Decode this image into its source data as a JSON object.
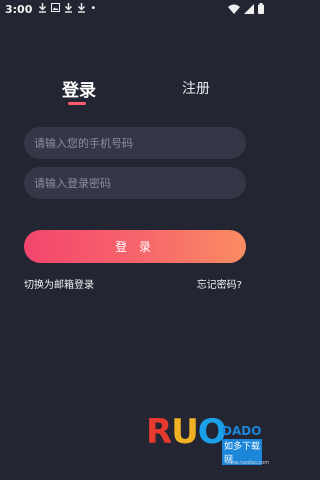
{
  "status_bar": {
    "time": "3:00",
    "notifications": [
      "download-icon",
      "image-icon",
      "download-icon",
      "download-icon"
    ],
    "dot": "•"
  },
  "tabs": {
    "login": "登录",
    "register": "注册"
  },
  "form": {
    "phone_placeholder": "请输入您的手机号码",
    "code_placeholder": "请输入登录密码",
    "login_button": "登 录"
  },
  "links": {
    "email_login": "切换为邮箱登录",
    "forgot_password": "忘记密码?"
  },
  "watermark": {
    "letters": "RUOD",
    "dado": "DADO",
    "cn": "如多下载网",
    "url": "www.ruodao.com"
  },
  "colors": {
    "background": "#232632",
    "field": "#333746",
    "accent": "#ff5a6e",
    "button_start": "#f3466d",
    "button_end": "#fb8d62"
  }
}
